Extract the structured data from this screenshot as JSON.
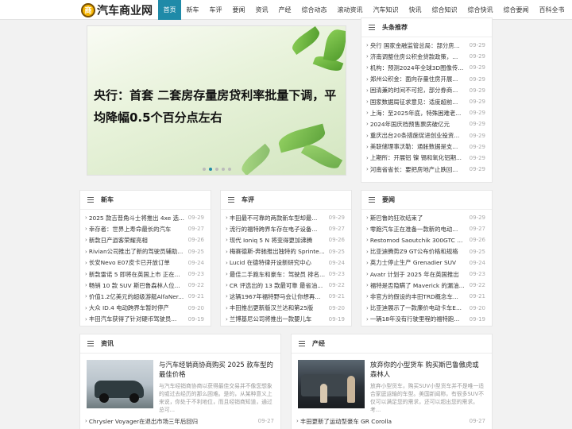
{
  "site": {
    "logo_text": "汽车商业网",
    "logo_mark": "商"
  },
  "nav": [
    "首页",
    "新车",
    "车评",
    "要闻",
    "资讯",
    "产经",
    "综合动态",
    "滚动资讯",
    "汽车知识",
    "快讯",
    "综合知识",
    "综合快讯",
    "综合要闻",
    "百科全书"
  ],
  "banner": {
    "caption": "央行：首套 二套房存量房贷利率批量下调，平均降幅0.5个百分点左右",
    "dots": 5,
    "active_dot": 1
  },
  "headlines": {
    "title": "头条推荐",
    "items": [
      {
        "t": "央行 国家金融监管总局：部分房...",
        "d": "09-29"
      },
      {
        "t": "济南调整住房公积金贷款政策，...",
        "d": "09-29"
      },
      {
        "t": "机构：预测2024年全球3D图像传...",
        "d": "09-29"
      },
      {
        "t": "郑州公积金：面向存量住房开展...",
        "d": "09-29"
      },
      {
        "t": "困清兼的时间不可挖，部分券商...",
        "d": "09-29"
      },
      {
        "t": "国家数据局征求意见：适度超前...",
        "d": "09-29"
      },
      {
        "t": "上海：至2025年底，特殊困难老...",
        "d": "09-29"
      },
      {
        "t": "2024年国庆档预售票房破亿元",
        "d": "09-29"
      },
      {
        "t": "重庆出台20条措施促进创业投资...",
        "d": "09-29"
      },
      {
        "t": "美联储理事沃勒：通胀数据是支...",
        "d": "09-29"
      },
      {
        "t": "上期所：开展铝 镍 锡和氧化铝期...",
        "d": "09-29"
      },
      {
        "t": "河南省省长：要把房地产止跌回...",
        "d": "09-29"
      }
    ]
  },
  "xinche": {
    "title": "新车",
    "items": [
      {
        "t": "2025 款吉普角斗士将推出 4xe 选...",
        "d": "09-29"
      },
      {
        "t": "幸存者：世界上寿命最长的汽车",
        "d": "09-27"
      },
      {
        "t": "新款日产逍客荣耀亮相",
        "d": "09-26"
      },
      {
        "t": "Rivian公司推出了新的驾驶员辅助...",
        "d": "09-25"
      },
      {
        "t": "长安Nevo E07皮卡已开放订单",
        "d": "09-24"
      },
      {
        "t": "新款雷诺 5 即将在英国上市 正在...",
        "d": "09-23"
      },
      {
        "t": "畅销 10 款 SUV 斯巴鲁森林人位...",
        "d": "09-22"
      },
      {
        "t": "价值1.2亿美元的超级游艇AlfaNer...",
        "d": "09-21"
      },
      {
        "t": "大众 ID.4 电动跨界车暂时停产",
        "d": "09-20"
      },
      {
        "t": "丰田汽车获得了针对硬币驾驶员...",
        "d": "09-19"
      }
    ]
  },
  "chep": {
    "title": "车评",
    "items": [
      {
        "t": "丰田最不可靠的两款新车型却最...",
        "d": "09-29"
      },
      {
        "t": "流行的福特跨界车存在电子设备...",
        "d": "09-27"
      },
      {
        "t": "现代 Ioniq 5 N 将变得更加沸腾",
        "d": "09-26"
      },
      {
        "t": "梅赛德斯-奔驰推出独特的 Sprinte...",
        "d": "09-25"
      },
      {
        "t": "Lucid 在德特律开设新研究中心",
        "d": "09-24"
      },
      {
        "t": "最佳二手跑车和豪车：驾驶员 排名...",
        "d": "09-23"
      },
      {
        "t": "CR 评选出的 13 款最可靠 最省油...",
        "d": "09-22"
      },
      {
        "t": "这辆1967年福特野马会让你想再...",
        "d": "09-21"
      },
      {
        "t": "丰田推出更新版汉兰达和第25版",
        "d": "09-20"
      },
      {
        "t": "兰博基尼公司将推出一款嬰儿车",
        "d": "09-19"
      }
    ]
  },
  "yaowen": {
    "title": "要闻",
    "items": [
      {
        "t": "斯巴鲁的狂欢结束了",
        "d": "09-29"
      },
      {
        "t": "零跑汽车正在准备一款新的电动...",
        "d": "09-27"
      },
      {
        "t": "Restomod Saoutchik 300GTC Ro...",
        "d": "09-26"
      },
      {
        "t": "比亚迪腾势Z9 GT公布价格和规格",
        "d": "09-25"
      },
      {
        "t": "英力士停止生产 Grenadier SUV",
        "d": "09-24"
      },
      {
        "t": "Avatr 计划于 2025 年在英国推出",
        "d": "09-23"
      },
      {
        "t": "福特是否隐瞒了 Maverick 的漏油...",
        "d": "09-22"
      },
      {
        "t": "非官方的假设的丰田TRD概念车...",
        "d": "09-21"
      },
      {
        "t": "比亚迪展示了一款廉价电动卡车E...",
        "d": "09-20"
      },
      {
        "t": "一辆18年没有行驶里程的福特跑...",
        "d": "09-19"
      }
    ]
  },
  "zixun": {
    "title": "资讯",
    "feature": {
      "title": "与汽车经销商协商购买 2025 款车型的最佳价格",
      "summary": "与汽车经销商协商以获得最佳交易并不像您想象的或过去经历的那么困难。是的，从某种意义上来说，你处于不利地位，而且经销商知道，通过总可..."
    },
    "items": [
      {
        "t": "Chrysler Voyager在退出市场三年后回归",
        "d": "09-27"
      }
    ]
  },
  "chanjing": {
    "title": "产经",
    "feature": {
      "title": "放弃你的小型货车 购买斯巴鲁傲虎或森林人",
      "summary": "放弃小型货车，购买SUV小型货车并不是唯一适合家庭运输的车型。美国新闻称，有很多SUV不仅可以满足您的需求，还可以超出您的需求。考..."
    },
    "items": [
      {
        "t": "丰田更新了运动型豪车 GR Corolla",
        "d": "09-27"
      }
    ]
  },
  "colors": {
    "accent": "#1f8aa8",
    "background": "#f2f2f2"
  }
}
